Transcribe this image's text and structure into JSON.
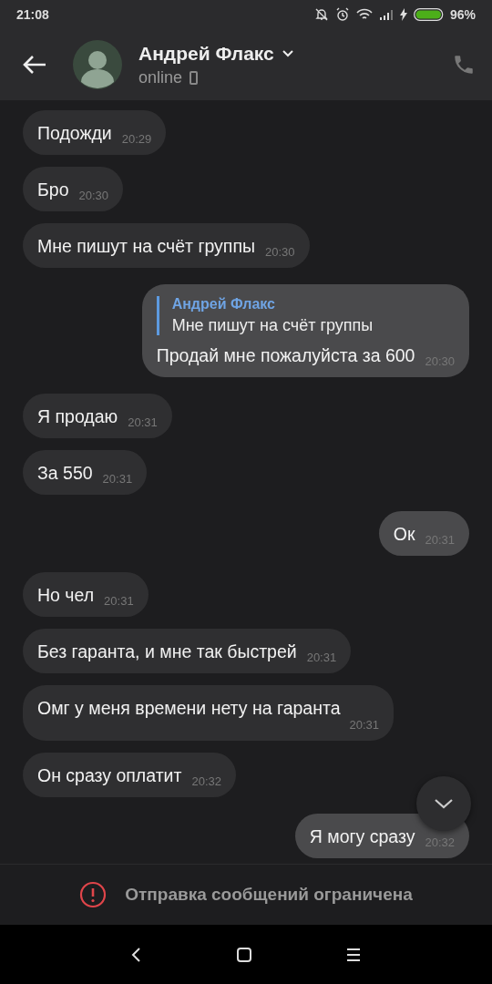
{
  "status_bar": {
    "time": "21:08",
    "battery": "96%"
  },
  "header": {
    "name": "Андрей Флакс",
    "status": "online"
  },
  "messages": [
    {
      "outgoing": false,
      "text": "Подожди",
      "time": "20:29"
    },
    {
      "outgoing": false,
      "text": "Бро",
      "time": "20:30"
    },
    {
      "outgoing": false,
      "text": "Мне пишут на счёт группы",
      "time": "20:30"
    },
    {
      "outgoing": true,
      "reply": {
        "author": "Андрей Флакс",
        "text": "Мне пишут на счёт группы"
      },
      "text": "Продай мне пожалуйста за 600",
      "time": "20:30"
    },
    {
      "outgoing": false,
      "text": "Я продаю",
      "time": "20:31"
    },
    {
      "outgoing": false,
      "text": "За 550",
      "time": "20:31"
    },
    {
      "outgoing": true,
      "text": "Ок",
      "time": "20:31"
    },
    {
      "outgoing": false,
      "text": "Но чел",
      "time": "20:31"
    },
    {
      "outgoing": false,
      "text": "Без гаранта, и мне так быстрей",
      "time": "20:31"
    },
    {
      "outgoing": false,
      "text": "Омг у меня времени нету на гаранта",
      "time": "20:31"
    },
    {
      "outgoing": false,
      "text": "Он сразу оплатит",
      "time": "20:32"
    },
    {
      "outgoing": true,
      "text": "Я могу сразу",
      "time": "20:32"
    }
  ],
  "notice": "Отправка сообщений ограничена"
}
